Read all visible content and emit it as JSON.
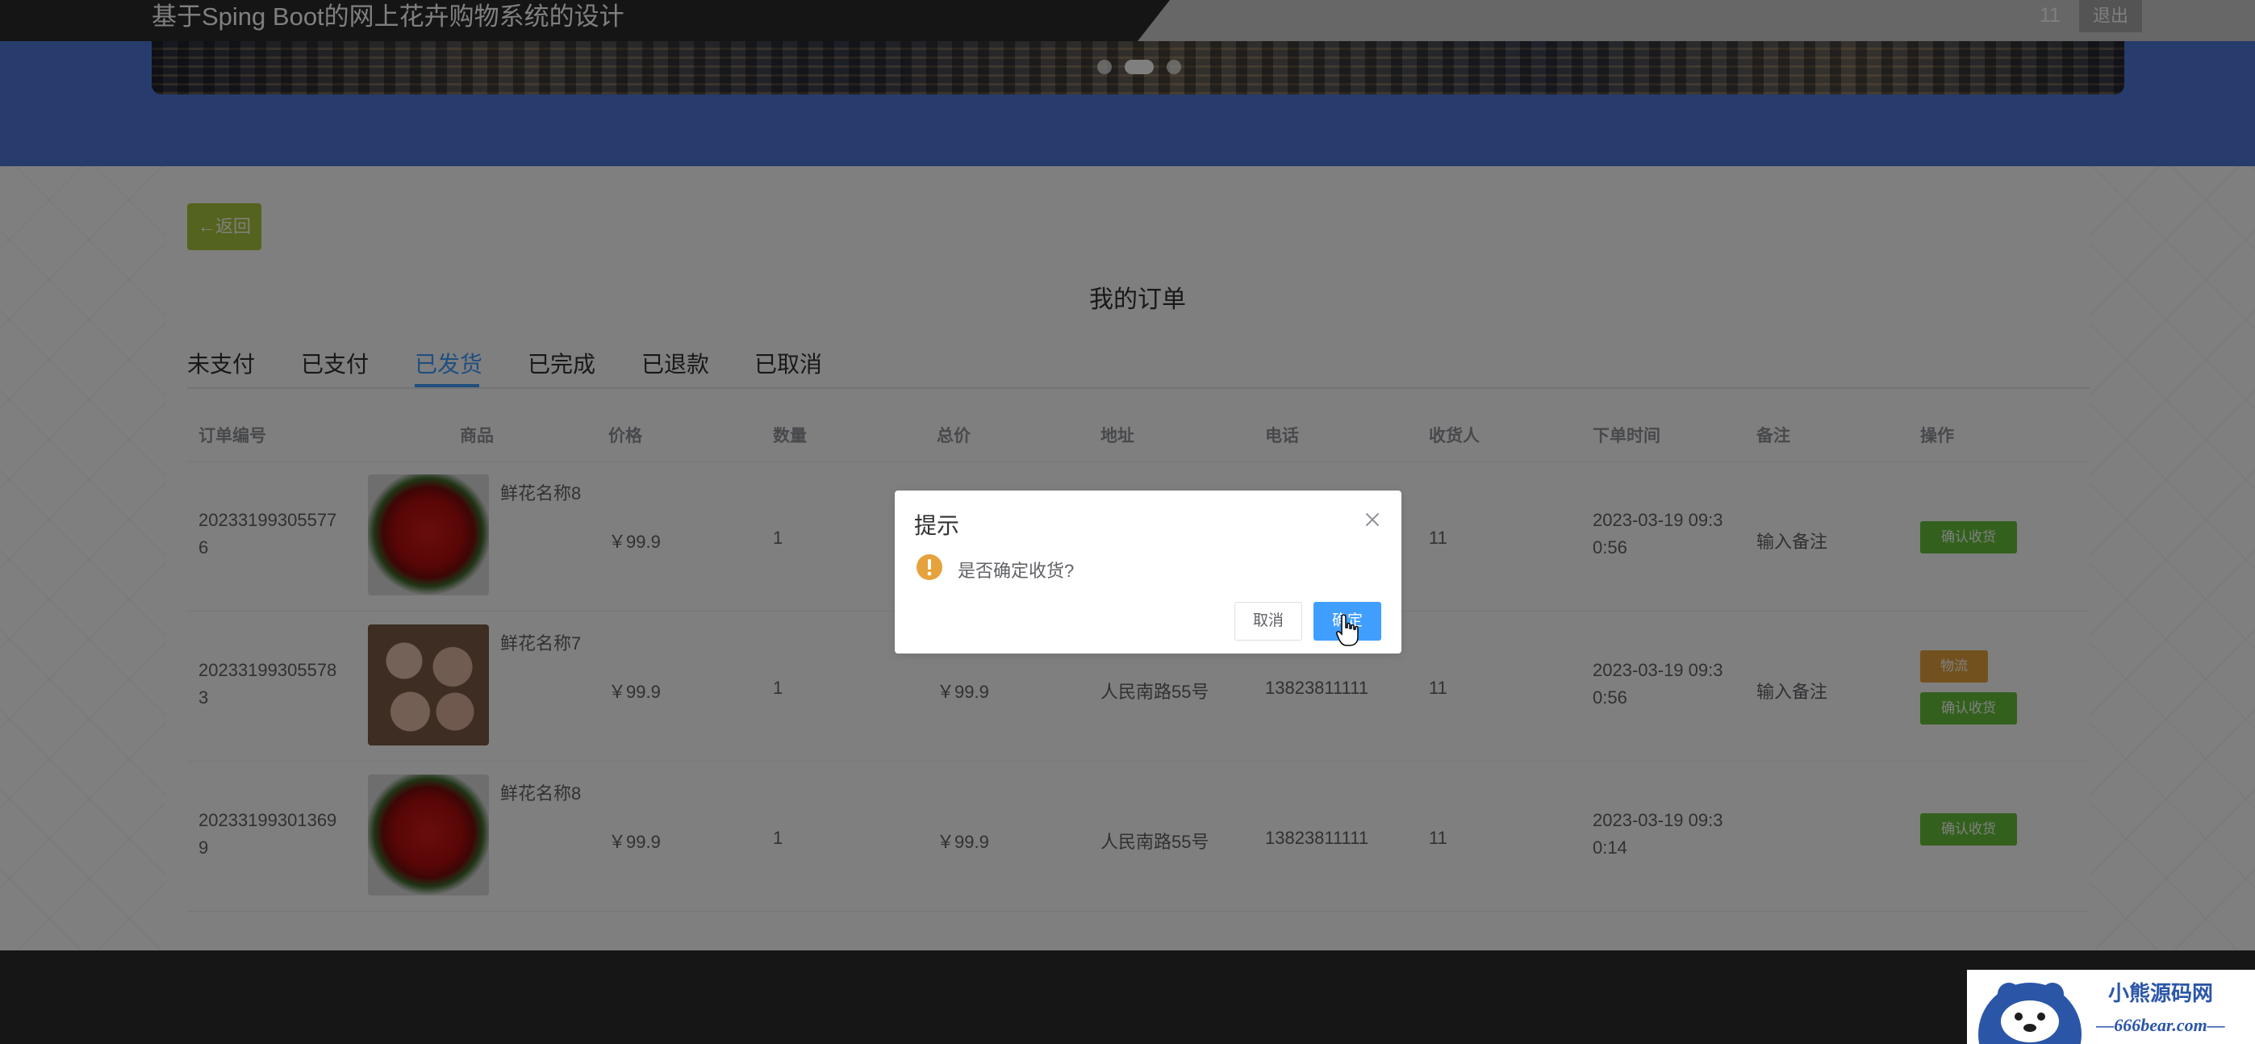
{
  "header": {
    "site_title": "基于Sping Boot的网上花卉购物系统的设计",
    "user_name": "11",
    "logout_label": "退出"
  },
  "page": {
    "back_label": "←返回",
    "title": "我的订单"
  },
  "tabs": [
    {
      "label": "未支付",
      "active": false
    },
    {
      "label": "已支付",
      "active": false
    },
    {
      "label": "已发货",
      "active": true
    },
    {
      "label": "已完成",
      "active": false
    },
    {
      "label": "已退款",
      "active": false
    },
    {
      "label": "已取消",
      "active": false
    }
  ],
  "table": {
    "columns": [
      "订单编号",
      "商品",
      "价格",
      "数量",
      "总价",
      "地址",
      "电话",
      "收货人",
      "下单时间",
      "备注",
      "操作"
    ],
    "rows": [
      {
        "order_no": "202331993055776",
        "goods_image": "red-roses",
        "goods_name": "鲜花名称8",
        "price": "￥99.9",
        "quantity": "1",
        "total": "",
        "address": "",
        "phone": "",
        "receiver": "11",
        "order_time": "2023-03-19 09:30:56",
        "remark": "输入备注",
        "actions": [
          "确认收货"
        ]
      },
      {
        "order_no": "202331993055783",
        "goods_image": "pink-roses",
        "goods_name": "鲜花名称7",
        "price": "￥99.9",
        "quantity": "1",
        "total": "￥99.9",
        "address": "人民南路55号",
        "phone": "13823811111",
        "receiver": "11",
        "order_time": "2023-03-19 09:30:56",
        "remark": "输入备注",
        "actions": [
          "物流",
          "确认收货"
        ]
      },
      {
        "order_no": "202331993013699",
        "goods_image": "red-roses",
        "goods_name": "鲜花名称8",
        "price": "￥99.9",
        "quantity": "1",
        "total": "￥99.9",
        "address": "人民南路55号",
        "phone": "13823811111",
        "receiver": "11",
        "order_time": "2023-03-19 09:30:14",
        "remark": "",
        "actions": [
          "确认收货"
        ]
      }
    ]
  },
  "dialog": {
    "title": "提示",
    "message": "是否确定收货?",
    "cancel_label": "取消",
    "ok_label": "确定"
  },
  "watermark": {
    "line1": "小熊源码网",
    "line2": "—666bear.com—"
  },
  "colors": {
    "hero": "#4f78d8",
    "primary": "#409eff",
    "success": "#67c23a",
    "warning": "#e6a23c",
    "back_button": "#a8c63b"
  }
}
